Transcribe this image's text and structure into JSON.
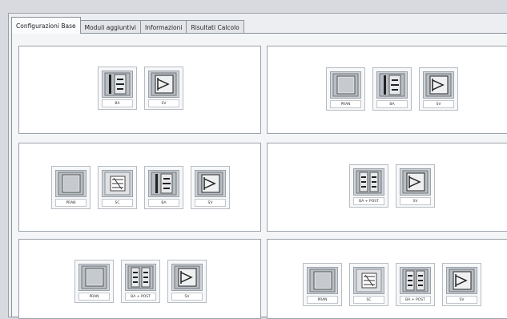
{
  "tabs": [
    {
      "label": "Configurazioni Base",
      "active": true
    },
    {
      "label": "Moduli aggiuntivi",
      "active": false
    },
    {
      "label": "Informazioni",
      "active": false
    },
    {
      "label": "Risultati Calcolo",
      "active": false
    }
  ],
  "groups": [
    {
      "modules": [
        {
          "label": "BA",
          "icon": "ba-module-icon"
        },
        {
          "label": "SV",
          "icon": "sv-module-icon"
        }
      ]
    },
    {
      "modules": [
        {
          "label": "PRAN",
          "icon": "pran-module-icon"
        },
        {
          "label": "BA",
          "icon": "ba-module-icon"
        },
        {
          "label": "SV",
          "icon": "sv-module-icon"
        }
      ]
    },
    {
      "modules": [
        {
          "label": "PRAN",
          "icon": "pran-module-icon"
        },
        {
          "label": "SC",
          "icon": "sc-module-icon"
        },
        {
          "label": "BA",
          "icon": "ba-module-icon"
        },
        {
          "label": "SV",
          "icon": "sv-module-icon"
        }
      ]
    },
    {
      "modules": [
        {
          "label": "BA + POST",
          "icon": "ba-post-module-icon"
        },
        {
          "label": "SV",
          "icon": "sv-module-icon"
        }
      ]
    },
    {
      "modules": [
        {
          "label": "PRAN",
          "icon": "pran-module-icon"
        },
        {
          "label": "BA + POST",
          "icon": "ba-post-module-icon"
        },
        {
          "label": "SV",
          "icon": "sv-module-icon"
        }
      ]
    },
    {
      "modules": [
        {
          "label": "PRAN",
          "icon": "pran-module-icon"
        },
        {
          "label": "SC",
          "icon": "sc-module-icon"
        },
        {
          "label": "BA + POST",
          "icon": "ba-post-module-icon"
        },
        {
          "label": "SV",
          "icon": "sv-module-icon"
        }
      ]
    }
  ]
}
